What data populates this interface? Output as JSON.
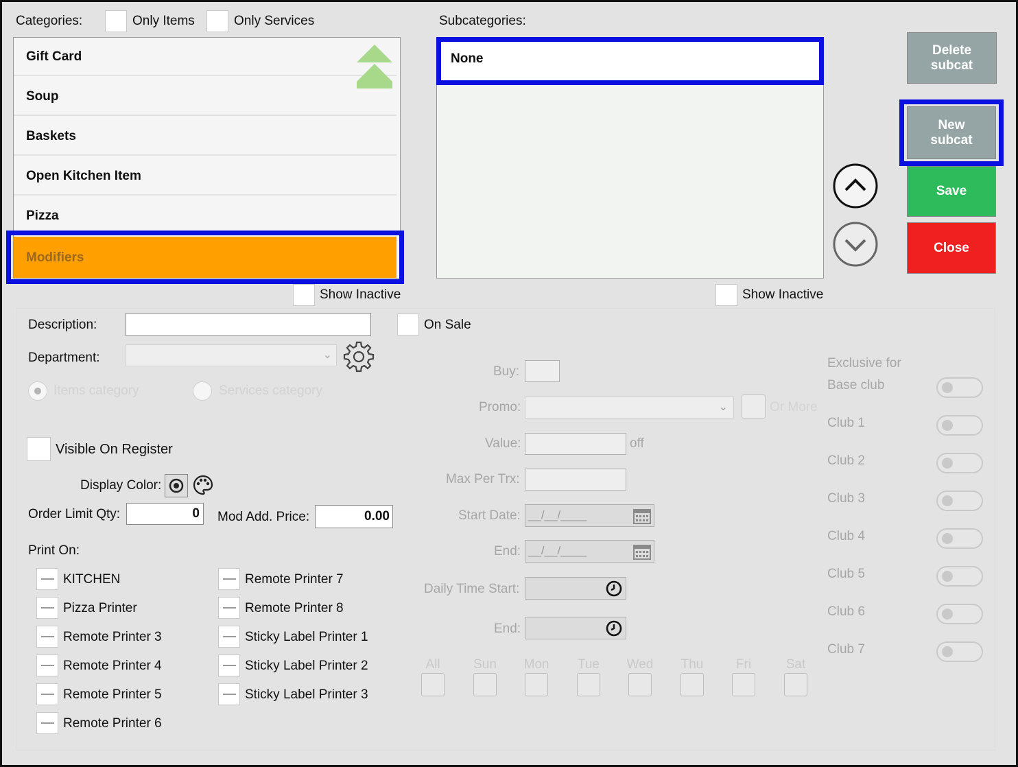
{
  "categories": {
    "label": "Categories:",
    "only_items": "Only Items",
    "only_services": "Only Services",
    "items": [
      "Gift Card",
      "Soup",
      "Baskets",
      "Open Kitchen Item",
      "Pizza",
      "Modifiers"
    ],
    "selected": "Modifiers",
    "show_inactive": "Show Inactive"
  },
  "subcategories": {
    "label": "Subcategories:",
    "items": [
      "None"
    ],
    "show_inactive": "Show Inactive"
  },
  "buttons": {
    "delete_subcat": "Delete\nsubcat",
    "new_subcat": "New\nsubcat",
    "save": "Save",
    "close": "Close"
  },
  "form": {
    "description_label": "Description:",
    "description_value": "",
    "on_sale": "On Sale",
    "department_label": "Department:",
    "items_category": "Items category",
    "services_category": "Services category",
    "visible_on_register": "Visible On Register",
    "display_color_label": "Display Color:",
    "order_limit_label": "Order Limit Qty:",
    "order_limit_value": "0",
    "mod_add_price_label": "Mod Add. Price:",
    "mod_add_price_value": "0.00",
    "print_on_label": "Print On:",
    "printers_col1": [
      "KITCHEN",
      "Pizza Printer",
      "Remote Printer 3",
      "Remote Printer 4",
      "Remote Printer 5",
      "Remote Printer 6"
    ],
    "printers_col2": [
      "Remote Printer 7",
      "Remote Printer 8",
      "Sticky Label Printer 1",
      "Sticky Label Printer 2",
      "Sticky Label Printer 3"
    ]
  },
  "promo": {
    "buy_label": "Buy:",
    "promo_label": "Promo:",
    "or_more": "Or More",
    "value_label": "Value:",
    "off": "off",
    "max_per_trx_label": "Max Per Trx:",
    "start_date_label": "Start Date:",
    "start_date_value": "__/__/____",
    "end_label": "End:",
    "end_date_value": "__/__/____",
    "daily_time_start_label": "Daily Time Start:",
    "time_end_label": "End:",
    "days": [
      "All",
      "Sun",
      "Mon",
      "Tue",
      "Wed",
      "Thu",
      "Fri",
      "Sat"
    ]
  },
  "clubs": {
    "exclusive_for": "Exclusive for",
    "items": [
      "Base club",
      "Club 1",
      "Club 2",
      "Club 3",
      "Club 4",
      "Club 5",
      "Club 6",
      "Club 7"
    ]
  }
}
